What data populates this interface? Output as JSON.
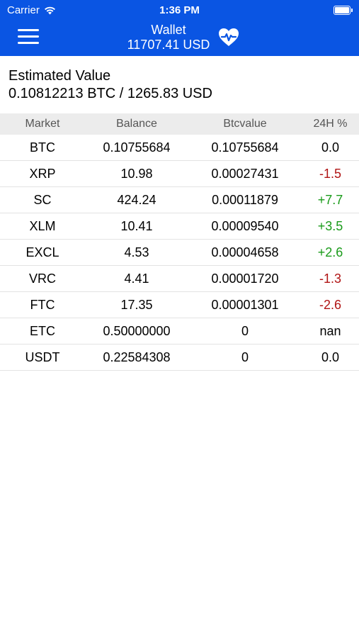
{
  "status_bar": {
    "carrier": "Carrier",
    "time": "1:36 PM"
  },
  "nav": {
    "title": "Wallet",
    "total": "11707.41 USD"
  },
  "summary": {
    "label": "Estimated Value",
    "value": "0.10812213 BTC / 1265.83 USD"
  },
  "table": {
    "headers": [
      "Market",
      "Balance",
      "Btcvalue",
      "24H %"
    ],
    "rows": [
      {
        "market": "BTC",
        "balance": "0.10755684",
        "btcvalue": "0.10755684",
        "change": "0.0"
      },
      {
        "market": "XRP",
        "balance": "10.98",
        "btcvalue": "0.00027431",
        "change": "-1.5"
      },
      {
        "market": "SC",
        "balance": "424.24",
        "btcvalue": "0.00011879",
        "change": "+7.7"
      },
      {
        "market": "XLM",
        "balance": "10.41",
        "btcvalue": "0.00009540",
        "change": "+3.5"
      },
      {
        "market": "EXCL",
        "balance": "4.53",
        "btcvalue": "0.00004658",
        "change": "+2.6"
      },
      {
        "market": "VRC",
        "balance": "4.41",
        "btcvalue": "0.00001720",
        "change": "-1.3"
      },
      {
        "market": "FTC",
        "balance": "17.35",
        "btcvalue": "0.00001301",
        "change": "-2.6"
      },
      {
        "market": "ETC",
        "balance": "0.50000000",
        "btcvalue": "0",
        "change": "nan"
      },
      {
        "market": "USDT",
        "balance": "0.22584308",
        "btcvalue": "0",
        "change": "0.0"
      }
    ]
  },
  "colors": {
    "nav_bg": "#0a55e3",
    "positive": "#1a9b1a",
    "negative": "#b01414"
  },
  "icons": {
    "menu": "hamburger-menu-icon",
    "health": "heart-pulse-icon",
    "wifi": "wifi-icon",
    "battery": "battery-icon"
  }
}
